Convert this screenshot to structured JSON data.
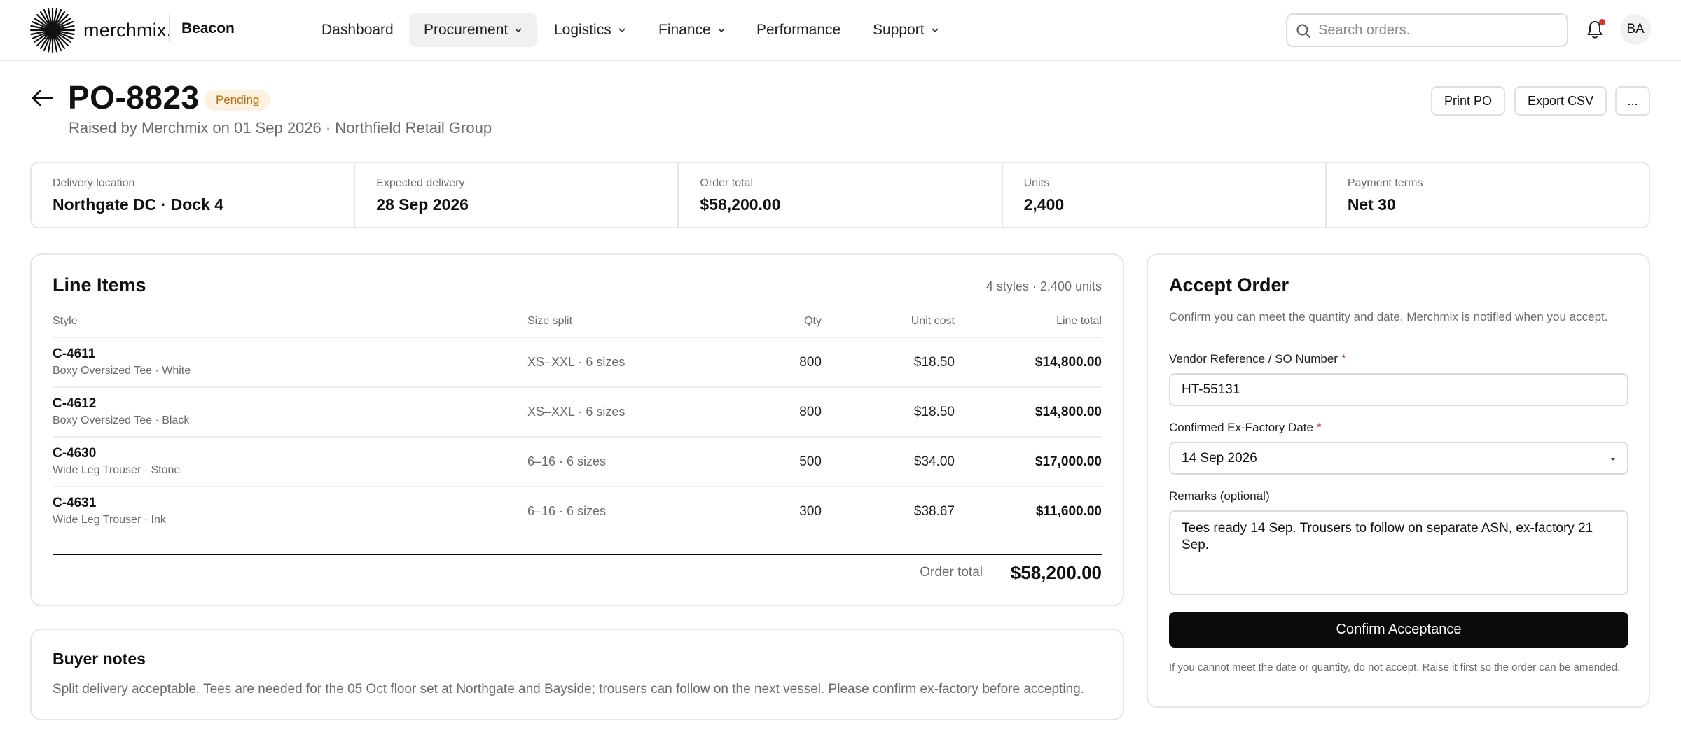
{
  "brand": {
    "logo_text": "merchmix.",
    "app_name": "Beacon"
  },
  "nav": [
    {
      "label": "Dashboard",
      "has_menu": false,
      "active": false
    },
    {
      "label": "Procurement",
      "has_menu": true,
      "active": true
    },
    {
      "label": "Logistics",
      "has_menu": true,
      "active": false
    },
    {
      "label": "Finance",
      "has_menu": true,
      "active": false
    },
    {
      "label": "Performance",
      "has_menu": false,
      "active": false
    },
    {
      "label": "Support",
      "has_menu": true,
      "active": false
    }
  ],
  "search": {
    "placeholder": "Search orders."
  },
  "notifications": {
    "icon": "bell-icon",
    "has_unread": true
  },
  "user": {
    "initials": "BA"
  },
  "header": {
    "po_number": "PO-8823",
    "status": "Pending",
    "subtitle": "Raised by Merchmix on 01 Sep 2026 · Northfield Retail Group",
    "actions": {
      "print": "Print PO",
      "export": "Export CSV",
      "more": "..."
    }
  },
  "summary": [
    {
      "label": "Delivery location",
      "value": "Northgate DC · Dock 4"
    },
    {
      "label": "Expected delivery",
      "value": "28 Sep 2026"
    },
    {
      "label": "Order total",
      "value": "$58,200.00"
    },
    {
      "label": "Units",
      "value": "2,400"
    },
    {
      "label": "Payment terms",
      "value": "Net 30"
    }
  ],
  "line_items": {
    "title": "Line Items",
    "meta": "4 styles · 2,400 units",
    "columns": {
      "style": "Style",
      "size": "Size split",
      "qty": "Qty",
      "cost": "Unit cost",
      "total": "Line total"
    },
    "rows": [
      {
        "style": "C-4611",
        "desc": "Boxy Oversized Tee · White",
        "size": "XS–XXL · 6 sizes",
        "qty": "800",
        "cost": "$18.50",
        "total": "$14,800.00"
      },
      {
        "style": "C-4612",
        "desc": "Boxy Oversized Tee · Black",
        "size": "XS–XXL · 6 sizes",
        "qty": "800",
        "cost": "$18.50",
        "total": "$14,800.00"
      },
      {
        "style": "C-4630",
        "desc": "Wide Leg Trouser · Stone",
        "size": "6–16 · 6 sizes",
        "qty": "500",
        "cost": "$34.00",
        "total": "$17,000.00"
      },
      {
        "style": "C-4631",
        "desc": "Wide Leg Trouser · Ink",
        "size": "6–16 · 6 sizes",
        "qty": "300",
        "cost": "$38.67",
        "total": "$11,600.00"
      }
    ],
    "total_label": "Order total",
    "total_value": "$58,200.00"
  },
  "buyer_notes": {
    "title": "Buyer notes",
    "text": "Split delivery acceptable. Tees are needed for the 05 Oct floor set at Northgate and Bayside; trousers can follow on the next vessel. Please confirm ex-factory before accepting."
  },
  "accept": {
    "title": "Accept Order",
    "intro": "Confirm you can meet the quantity and date. Merchmix is notified when you accept.",
    "vendor_ref_label": "Vendor Reference / SO Number",
    "vendor_ref_value": "HT-55131",
    "exfactory_label": "Confirmed Ex-Factory Date",
    "exfactory_value": "14 Sep 2026",
    "remarks_label": "Remarks (optional)",
    "remarks_value": "Tees ready 14 Sep. Trousers to follow on separate ASN, ex-factory 21 Sep.",
    "required_mark": "*",
    "confirm_label": "Confirm Acceptance",
    "footnote": "If you cannot meet the date or quantity, do not accept. Raise it first so the order can be amended."
  },
  "colors": {
    "accent": "#0b0b0b",
    "pending_bg": "#fdf1df",
    "pending_text": "#b36a12",
    "required": "#d9352f",
    "unread_dot": "#e0302a"
  }
}
